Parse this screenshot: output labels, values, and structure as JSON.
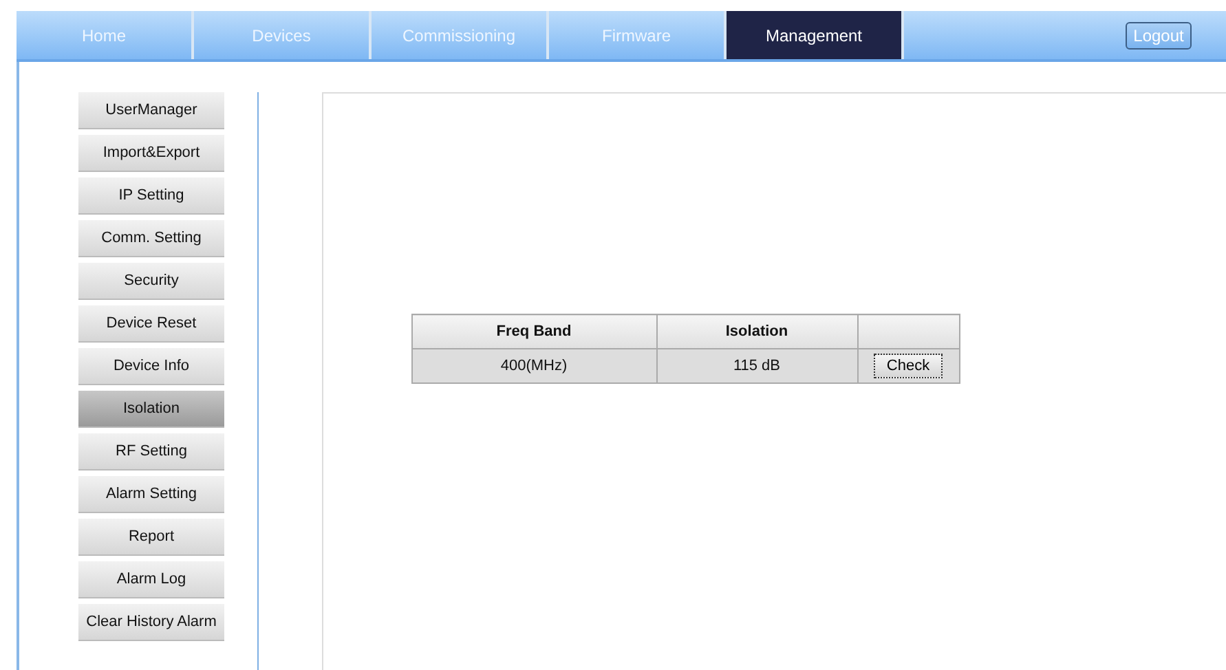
{
  "nav": {
    "tabs": [
      {
        "label": "Home",
        "selected": false
      },
      {
        "label": "Devices",
        "selected": false
      },
      {
        "label": "Commissioning",
        "selected": false
      },
      {
        "label": "Firmware",
        "selected": false
      },
      {
        "label": "Management",
        "selected": true
      }
    ],
    "logout": "Logout"
  },
  "sidebar": {
    "items": [
      {
        "label": "UserManager",
        "selected": false
      },
      {
        "label": "Import&Export",
        "selected": false
      },
      {
        "label": "IP Setting",
        "selected": false
      },
      {
        "label": "Comm. Setting",
        "selected": false
      },
      {
        "label": "Security",
        "selected": false
      },
      {
        "label": "Device Reset",
        "selected": false
      },
      {
        "label": "Device Info",
        "selected": false
      },
      {
        "label": "Isolation",
        "selected": true
      },
      {
        "label": "RF Setting",
        "selected": false
      },
      {
        "label": "Alarm Setting",
        "selected": false
      },
      {
        "label": "Report",
        "selected": false
      },
      {
        "label": "Alarm Log",
        "selected": false
      },
      {
        "label": "Clear History Alarm",
        "selected": false
      }
    ]
  },
  "table": {
    "columns": [
      "Freq Band",
      "Isolation"
    ],
    "rows": [
      {
        "freq_band": "400(MHz)",
        "isolation": "115 dB",
        "action": "Check"
      }
    ]
  }
}
